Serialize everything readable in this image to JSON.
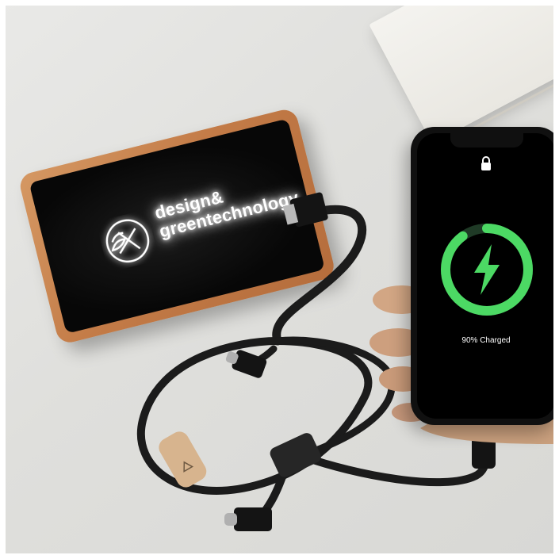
{
  "scene": {
    "description_colors": {
      "background": "#e0e0dd",
      "powerbank_wood": "#c37b47",
      "powerbank_face": "#0a0a0a",
      "cable": "#1a1a1a",
      "charge_ring": "#4cd964"
    }
  },
  "powerbank": {
    "brand_line1": "design&",
    "brand_line2": "greentechnology",
    "logo_icon": "leaf-x-logo-icon"
  },
  "phone": {
    "lock_icon": "lock-icon",
    "charge_icon": "lightning-bolt-icon",
    "charge_level": 0.9,
    "charge_status": "90% Charged"
  }
}
